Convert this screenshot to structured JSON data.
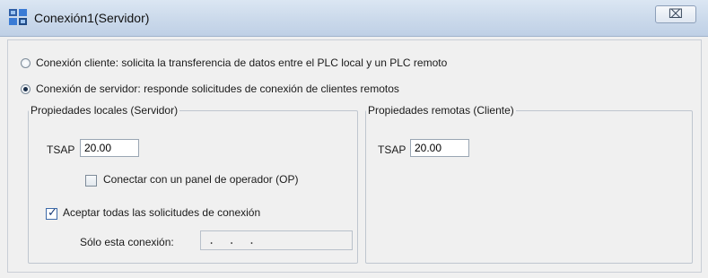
{
  "window": {
    "title": "Conexión1(Servidor)",
    "close_glyph": "⌧"
  },
  "connection_mode": {
    "client_label": "Conexión cliente: solicita la transferencia de datos entre el PLC local y un PLC remoto",
    "server_label": "Conexión de servidor: responde solicitudes de conexión de clientes remotos",
    "selected": "server"
  },
  "local": {
    "legend": "Propiedades locales (Servidor)",
    "tsap_label": "TSAP",
    "tsap_value": "20.00",
    "op_panel_label": "Conectar con un panel de operador (OP)",
    "op_panel_checked": false,
    "accept_all_label": "Aceptar todas las solicitudes de conexión",
    "accept_all_checked": true,
    "only_this_label": "Sólo esta conexión:",
    "only_this_value": ".   .   ."
  },
  "remote": {
    "legend": "Propiedades remotas (Cliente)",
    "tsap_label": "TSAP",
    "tsap_value": "20.00"
  },
  "icons": {
    "app": "network-connection-icon",
    "close": "close-icon"
  }
}
